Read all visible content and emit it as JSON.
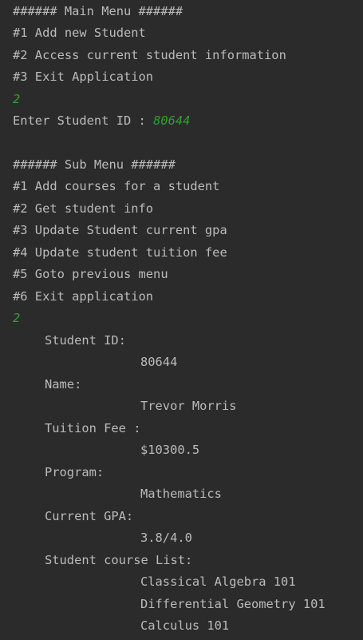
{
  "main_menu": {
    "header": "###### Main Menu ######",
    "options": [
      "#1 Add new Student",
      "#2 Access current student information",
      "#3 Exit Application"
    ],
    "choice": "2",
    "id_prompt": "Enter Student ID : ",
    "id_input": "80644"
  },
  "sub_menu": {
    "header": "###### Sub Menu ######",
    "options": [
      "#1 Add courses for a student",
      "#2 Get student info",
      "#3 Update Student current gpa",
      "#4 Update student tuition fee",
      "#5 Goto previous menu",
      "#6 Exit application"
    ],
    "choice": "2"
  },
  "student_info": {
    "id_label": "Student ID:",
    "id_value": "80644",
    "name_label": "Name:",
    "name_value": "Trevor Morris",
    "fee_label": "Tuition Fee :",
    "fee_value": "$10300.5",
    "program_label": "Program:",
    "program_value": "Mathematics",
    "gpa_label": "Current GPA:",
    "gpa_value": "3.8/4.0",
    "courses_label": "Student course List:",
    "courses": [
      "Classical Algebra 101",
      "Differential Geometry 101",
      "Calculus 101"
    ]
  },
  "colors": {
    "background": "#2b2b2b",
    "output_text": "#bbbbbb",
    "user_input": "#2fa02f"
  }
}
